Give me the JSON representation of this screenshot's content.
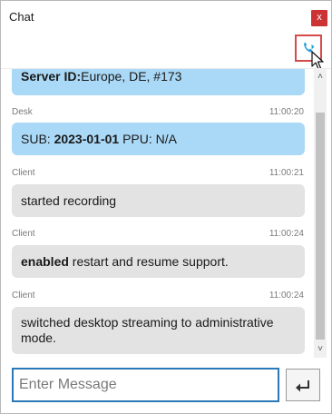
{
  "window": {
    "title": "Chat",
    "close_label": "x"
  },
  "toolbar": {
    "call_icon": "phone-transfer-icon"
  },
  "messages": [
    {
      "sender": "",
      "time": "",
      "style": "blue",
      "parts": [
        {
          "text": "Server ID:",
          "bold": true
        },
        {
          "text": "Europe, DE, #173",
          "bold": false
        }
      ]
    },
    {
      "sender": "Desk",
      "time": "11:00:20",
      "style": "blue",
      "parts": [
        {
          "text": "SUB: ",
          "bold": false
        },
        {
          "text": "2023-01-01",
          "bold": true
        },
        {
          "text": " PPU: N/A",
          "bold": false
        }
      ]
    },
    {
      "sender": "Client",
      "time": "11:00:21",
      "style": "grey",
      "parts": [
        {
          "text": "started recording",
          "bold": false
        }
      ]
    },
    {
      "sender": "Client",
      "time": "11:00:24",
      "style": "grey",
      "parts": [
        {
          "text": "enabled",
          "bold": true
        },
        {
          "text": " restart and resume support.",
          "bold": false
        }
      ]
    },
    {
      "sender": "Client",
      "time": "11:00:24",
      "style": "grey",
      "parts": [
        {
          "text": "switched desktop streaming to administrative mode.",
          "bold": false
        }
      ]
    }
  ],
  "composer": {
    "placeholder": "Enter Message",
    "value": "",
    "send_icon": "enter-return-icon"
  },
  "colors": {
    "accent": "#2b78b8",
    "bubble_blue": "#aad9f7",
    "bubble_grey": "#e3e3e3",
    "close_red": "#cc3333",
    "highlight_red": "#d54a4a",
    "call_blue": "#2a9fd8"
  }
}
